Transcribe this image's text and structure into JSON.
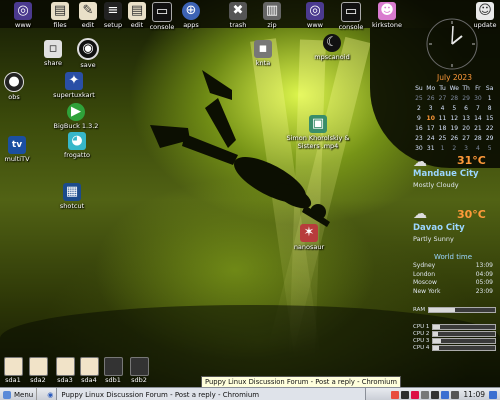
{
  "top_icons": [
    {
      "id": "www1",
      "label": "www",
      "glyph": "◎",
      "color": "#4b3a8f"
    },
    {
      "id": "files",
      "label": "files",
      "glyph": "▤",
      "color": "#e9e0c8"
    },
    {
      "id": "edit",
      "label": "edit",
      "glyph": "✎",
      "color": "#e9e0c8"
    },
    {
      "id": "setup",
      "label": "setup",
      "glyph": "≡",
      "color": "#222"
    },
    {
      "id": "edit2",
      "label": "edit",
      "glyph": "▤",
      "color": "#e9e0c8"
    },
    {
      "id": "console1",
      "label": "console",
      "glyph": "▭",
      "color": "#111"
    },
    {
      "id": "apps",
      "label": "apps",
      "glyph": "⊕",
      "color": "#3d63b5"
    },
    {
      "id": "trash",
      "label": "trash",
      "glyph": "✖",
      "color": "#555"
    },
    {
      "id": "zip",
      "label": "zip",
      "glyph": "▥",
      "color": "#666"
    },
    {
      "id": "www2",
      "label": "www",
      "glyph": "◎",
      "color": "#4b3a8f"
    },
    {
      "id": "console2",
      "label": "console",
      "glyph": "▭",
      "color": "#111"
    },
    {
      "id": "kirkstone",
      "label": "kirkstone",
      "glyph": "☻",
      "color": "#d97bcf"
    },
    {
      "id": "update",
      "label": "update",
      "glyph": "☺",
      "color": "#e9e9e9"
    }
  ],
  "desktop_icons": [
    {
      "id": "share",
      "label": "share",
      "glyph": "▫",
      "color": "#e0e0e0"
    },
    {
      "id": "save",
      "label": "save",
      "glyph": "◉",
      "color": "#111"
    },
    {
      "id": "knta",
      "label": "knta",
      "glyph": "▪",
      "color": "#777"
    },
    {
      "id": "mpscanoid",
      "label": "mpscanoid",
      "glyph": "☾",
      "color": "#111"
    },
    {
      "id": "obs",
      "label": "obs",
      "glyph": "●",
      "color": "#222"
    },
    {
      "id": "supertuxkart",
      "label": "supertuxkart",
      "glyph": "✦",
      "color": "#2a4fa6"
    },
    {
      "id": "bigbuck",
      "label": "BigBuck 1.3.2",
      "glyph": "▶",
      "color": "#2fa23a"
    },
    {
      "id": "video",
      "label": "Simon Khorolskiy & Sisters .mp4",
      "glyph": "▣",
      "color": "#3a8d6a"
    },
    {
      "id": "multitv",
      "label": "multiTV",
      "glyph": "tv",
      "color": "#1b4fa0"
    },
    {
      "id": "frogatto",
      "label": "frogatto",
      "glyph": "◕",
      "color": "#37b7c9"
    },
    {
      "id": "shotcut",
      "label": "shotcut",
      "glyph": "▦",
      "color": "#1c4b8c"
    },
    {
      "id": "nanosaur",
      "label": "nanosaur",
      "glyph": "✶",
      "color": "#b83c3c"
    }
  ],
  "calendar": {
    "title": "July  2023",
    "weekdays": [
      "Su",
      "Mo",
      "Tu",
      "We",
      "Th",
      "Fr",
      "Sa"
    ],
    "rows": [
      [
        "25",
        "26",
        "27",
        "28",
        "29",
        "30",
        "1"
      ],
      [
        "2",
        "3",
        "4",
        "5",
        "6",
        "7",
        "8"
      ],
      [
        "9",
        "10",
        "11",
        "12",
        "13",
        "14",
        "15"
      ],
      [
        "16",
        "17",
        "18",
        "19",
        "20",
        "21",
        "22"
      ],
      [
        "23",
        "24",
        "25",
        "26",
        "27",
        "28",
        "29"
      ],
      [
        "30",
        "31",
        "1",
        "2",
        "3",
        "4",
        "5"
      ]
    ],
    "today": "10"
  },
  "weather": [
    {
      "temp": "31°C",
      "city": "Mandaue City",
      "condition": "Mostly Cloudy"
    },
    {
      "temp": "30°C",
      "city": "Davao City",
      "condition": "Partly Sunny"
    }
  ],
  "world_time": {
    "title": "World time",
    "rows": [
      {
        "city": "Sydney",
        "time": "13:09"
      },
      {
        "city": "London",
        "time": "04:09"
      },
      {
        "city": "Moscow",
        "time": "05:09"
      },
      {
        "city": "New York",
        "time": "23:09"
      }
    ]
  },
  "meters": {
    "ram": {
      "label": "RAM",
      "level": 0.4
    },
    "cpus": [
      {
        "label": "CPU 1",
        "level": 0.1
      },
      {
        "label": "CPU 2",
        "level": 0.08
      },
      {
        "label": "CPU 3",
        "level": 0.12
      },
      {
        "label": "CPU 4",
        "level": 0.09
      }
    ]
  },
  "drives": [
    {
      "label": "sda1"
    },
    {
      "label": "sda2"
    },
    {
      "label": "sda3"
    },
    {
      "label": "sda4"
    },
    {
      "label": "sdb1"
    },
    {
      "label": "sdb2"
    }
  ],
  "taskbar": {
    "menu": "Menu",
    "window_title": "Puppy Linux Discussion Forum - Post a reply - Chromium",
    "clock": "11:09"
  },
  "tooltip": "Puppy Linux Discussion Forum - Post a reply - Chromium"
}
